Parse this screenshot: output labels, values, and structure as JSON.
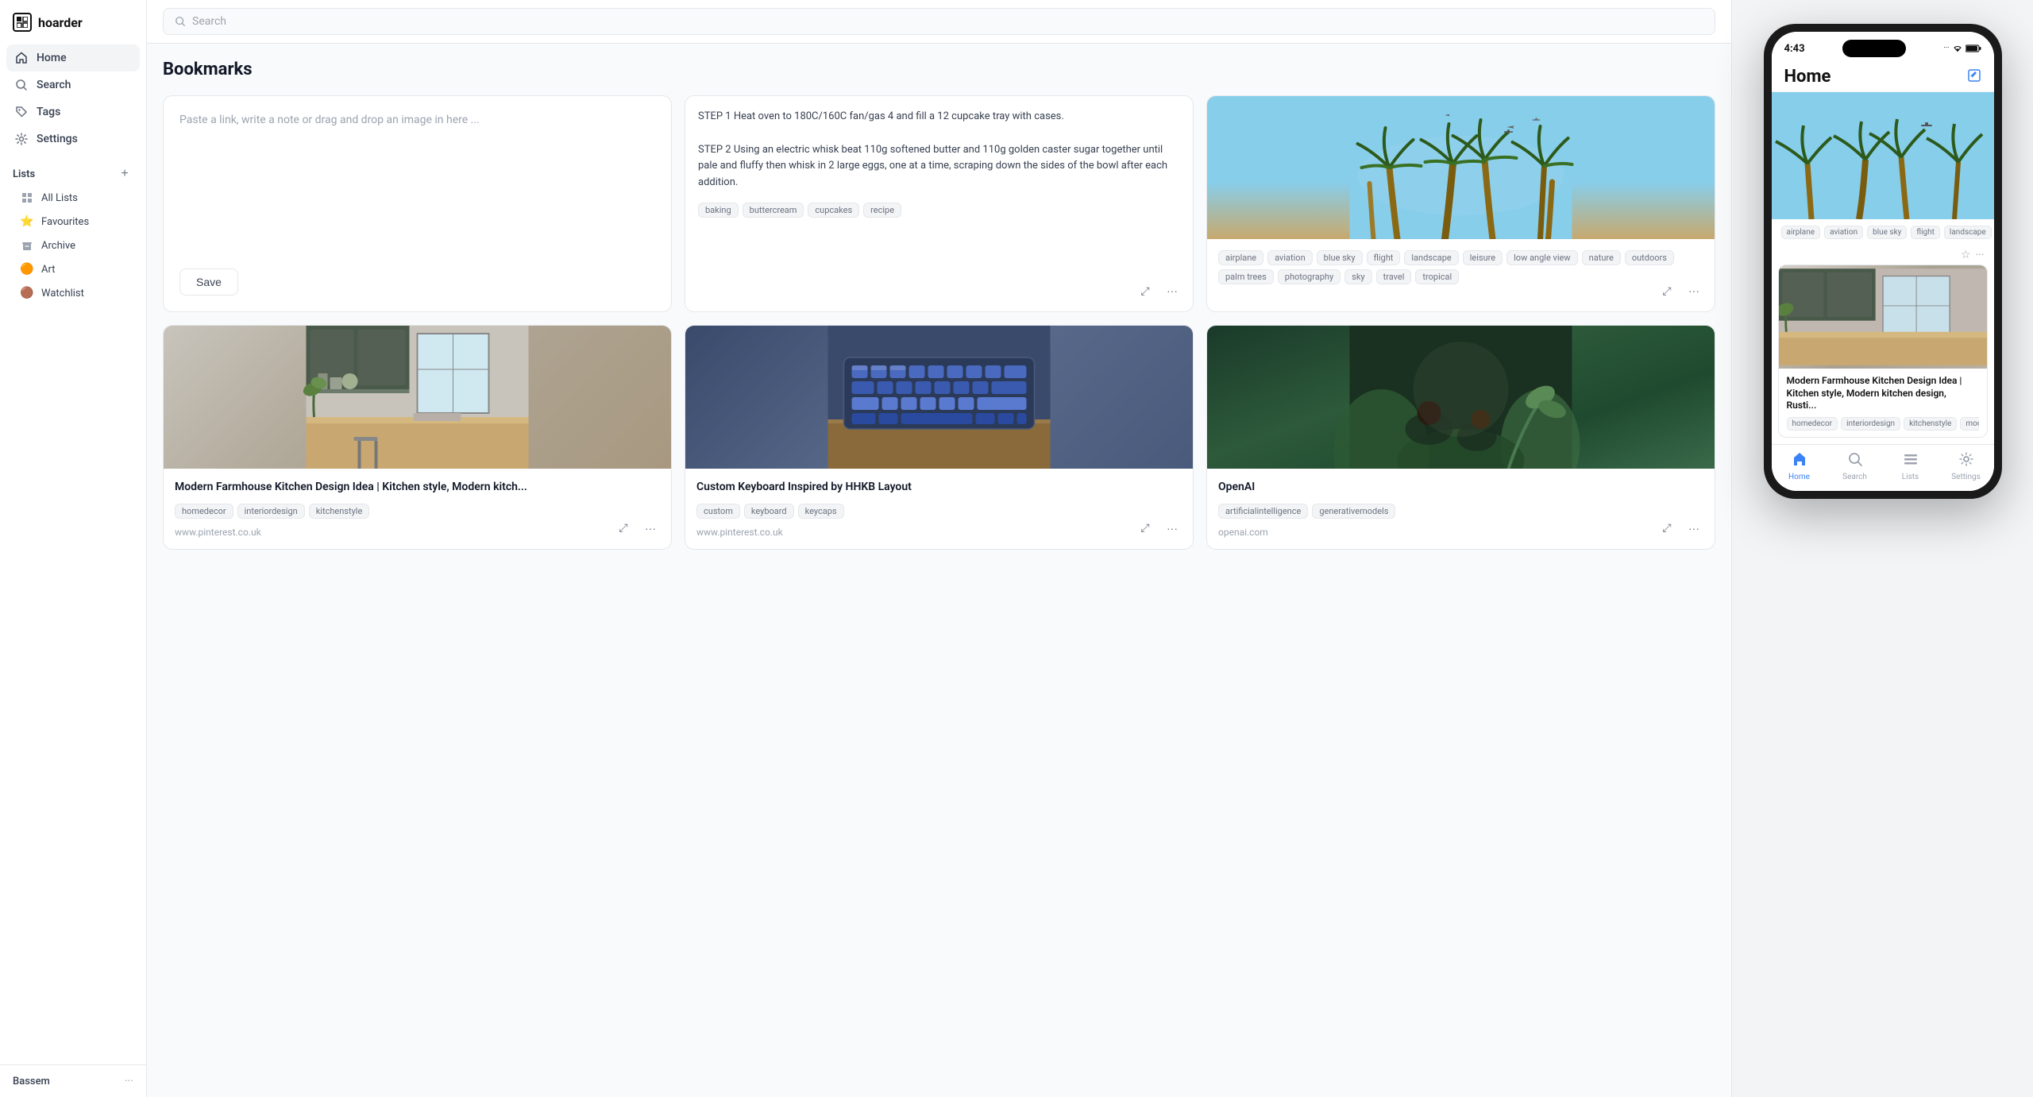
{
  "app": {
    "name": "hoarder"
  },
  "sidebar": {
    "nav": [
      {
        "id": "home",
        "label": "Home",
        "icon": "home"
      },
      {
        "id": "search",
        "label": "Search",
        "icon": "search"
      },
      {
        "id": "tags",
        "label": "Tags",
        "icon": "tag"
      },
      {
        "id": "settings",
        "label": "Settings",
        "icon": "settings"
      }
    ],
    "lists_header": "Lists",
    "lists": [
      {
        "id": "all-lists",
        "label": "All Lists",
        "icon": "grid"
      },
      {
        "id": "favourites",
        "label": "Favourites",
        "icon": "star"
      },
      {
        "id": "archive",
        "label": "Archive",
        "icon": "archive"
      },
      {
        "id": "art",
        "label": "Art",
        "icon": "circle-orange"
      },
      {
        "id": "watchlist",
        "label": "Watchlist",
        "icon": "circle-brown"
      }
    ],
    "footer_user": "Bassem",
    "footer_dots": "..."
  },
  "topbar": {
    "search_placeholder": "Search"
  },
  "main": {
    "page_title": "Bookmarks"
  },
  "new_bookmark": {
    "placeholder": "Paste a link, write a note or drag and drop an image in here ...",
    "save_label": "Save"
  },
  "cards": [
    {
      "id": "recipe",
      "type": "text",
      "content": "STEP 1 Heat oven to 180C/160C fan/gas 4 and fill a 12 cupcake tray with cases.\n\nSTEP 2 Using an electric whisk beat 110g softened butter and 110g golden caster sugar together until pale and fluffy then whisk in 2 large eggs, one at a time, scraping down the sides of the bowl after each addition.",
      "tags": [
        "baking",
        "buttercream",
        "cupcakes",
        "recipe"
      ]
    },
    {
      "id": "palm-trees",
      "type": "image",
      "tags": [
        "airplane",
        "aviation",
        "blue sky",
        "flight",
        "landscape",
        "leisure",
        "low angle view",
        "nature",
        "outdoors",
        "palm trees",
        "photography",
        "sky",
        "travel",
        "tropical"
      ]
    },
    {
      "id": "kitchen",
      "type": "link",
      "title": "Modern Farmhouse Kitchen Design Idea | Kitchen style, Modern kitch...",
      "url": "www.pinterest.co.uk",
      "tags": [
        "homedecor",
        "interiordesign",
        "kitchenstyle"
      ]
    },
    {
      "id": "keyboard",
      "type": "link",
      "title": "Custom Keyboard Inspired by HHKB Layout",
      "url": "www.pinterest.co.uk",
      "tags": [
        "custom",
        "keyboard",
        "keycaps"
      ]
    },
    {
      "id": "openai",
      "type": "link",
      "title": "OpenAI",
      "url": "openai.com",
      "tags": [
        "artificialintelligence",
        "generativemodels"
      ]
    }
  ],
  "phone": {
    "status_time": "4:43",
    "status_dots": "···",
    "page_title": "Home",
    "card1_tags": [
      "airplane",
      "aviation",
      "blue sky",
      "flight",
      "landscape"
    ],
    "card2_title": "Modern Farmhouse Kitchen Design Idea | Kitchen style, Modern kitchen design, Rusti...",
    "card2_tags": [
      "homedecor",
      "interiordesign",
      "kitchenstyle",
      "modern"
    ],
    "nav": [
      {
        "id": "home",
        "label": "Home",
        "icon": "🏠",
        "active": true
      },
      {
        "id": "search",
        "label": "Search",
        "icon": "🔍",
        "active": false
      },
      {
        "id": "lists",
        "label": "Lists",
        "icon": "☰",
        "active": false
      },
      {
        "id": "settings",
        "label": "Settings",
        "icon": "⚙",
        "active": false
      }
    ]
  }
}
